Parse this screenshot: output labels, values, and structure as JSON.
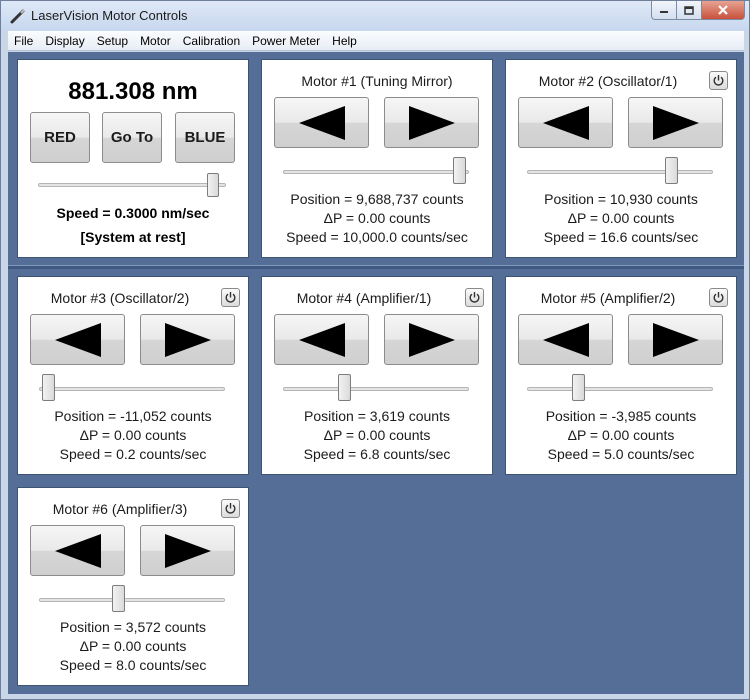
{
  "window": {
    "title": "LaserVision Motor Controls",
    "app_icon": "laser-pen-icon",
    "controls": {
      "minimize": "minimize-icon",
      "maximize": "maximize-icon",
      "close": "close-icon"
    }
  },
  "menu": [
    "File",
    "Display",
    "Setup",
    "Motor",
    "Calibration",
    "Power Meter",
    "Help"
  ],
  "main": {
    "wavelength": "881.308 nm",
    "red_label": "RED",
    "goto_label": "Go To",
    "blue_label": "BLUE",
    "speed_text": "Speed = 0.3000 nm/sec",
    "status_text": "[System at rest]",
    "slider_fraction": 0.96
  },
  "motors": [
    {
      "title": "Motor #1 (Tuning Mirror)",
      "has_power": false,
      "slider_fraction": 0.98,
      "position": "Position = 9,688,737 counts",
      "delta": "ΔP = 0.00 counts",
      "speed": "Speed = 10,000.0 counts/sec"
    },
    {
      "title": "Motor #2 (Oscillator/1)",
      "has_power": true,
      "slider_fraction": 0.8,
      "position": "Position = 10,930 counts",
      "delta": "ΔP = 0.00 counts",
      "speed": "Speed = 16.6 counts/sec"
    },
    {
      "title": "Motor #3 (Oscillator/2)",
      "has_power": true,
      "slider_fraction": 0.02,
      "position": "Position = -11,052 counts",
      "delta": "ΔP = 0.00 counts",
      "speed": "Speed = 0.2 counts/sec"
    },
    {
      "title": "Motor #4 (Amplifier/1)",
      "has_power": true,
      "slider_fraction": 0.32,
      "position": "Position = 3,619 counts",
      "delta": "ΔP = 0.00 counts",
      "speed": "Speed = 6.8 counts/sec"
    },
    {
      "title": "Motor #5 (Amplifier/2)",
      "has_power": true,
      "slider_fraction": 0.26,
      "position": "Position = -3,985 counts",
      "delta": "ΔP = 0.00 counts",
      "speed": "Speed = 5.0 counts/sec"
    },
    {
      "title": "Motor #6 (Amplifier/3)",
      "has_power": true,
      "slider_fraction": 0.42,
      "position": "Position = 3,572 counts",
      "delta": "ΔP = 0.00 counts",
      "speed": "Speed = 8.0 counts/sec"
    }
  ],
  "icons": {
    "left": "arrow-left-icon",
    "right": "arrow-right-icon",
    "power": "power-icon"
  }
}
